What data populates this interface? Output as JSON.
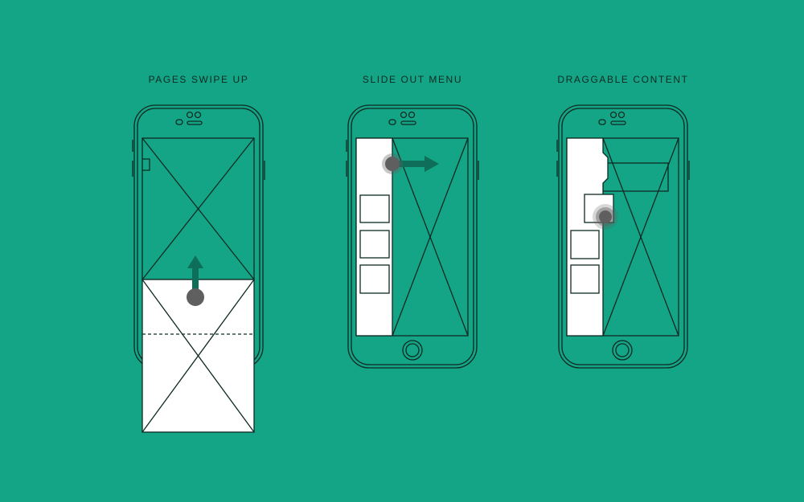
{
  "colors": {
    "background": "#14a587",
    "outline": "#0e2a22",
    "panel": "#ffffff",
    "touch": "#5f5f5f",
    "arrow": "#0f6e59"
  },
  "panels": [
    {
      "id": "swipe-up",
      "caption": "PAGES SWIPE UP",
      "gesture": "swipe-up"
    },
    {
      "id": "slide-menu",
      "caption": "SLIDE OUT MENU",
      "gesture": "slide-right"
    },
    {
      "id": "drag",
      "caption": "DRAGGABLE CONTENT",
      "gesture": "drag"
    }
  ]
}
